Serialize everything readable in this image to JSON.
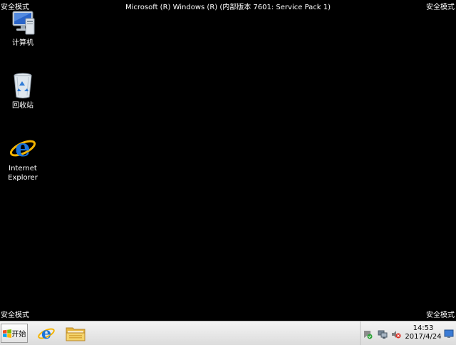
{
  "safe_mode_label": "安全模式",
  "version_text": "Microsoft (R) Windows (R) (内部版本 7601: Service Pack 1)",
  "desktop_icons": [
    {
      "label": "计算机",
      "icon": "computer-icon"
    },
    {
      "label": "回收站",
      "icon": "recycle-bin-icon"
    },
    {
      "label": "Internet\nExplorer",
      "icon": "internet-explorer-icon"
    }
  ],
  "taskbar": {
    "start_label": "开始",
    "pinned": [
      {
        "icon": "internet-explorer-icon"
      },
      {
        "icon": "file-explorer-icon"
      }
    ],
    "tray": {
      "icons": [
        "action-center-icon",
        "network-icon",
        "volume-muted-icon"
      ],
      "time": "14:53",
      "date": "2017/4/24"
    }
  },
  "colors": {
    "desktop_background": "#000000",
    "taskbar_background": "#e6e6e6",
    "ie_blue": "#1a73d9",
    "folder_yellow": "#f1c84b"
  }
}
